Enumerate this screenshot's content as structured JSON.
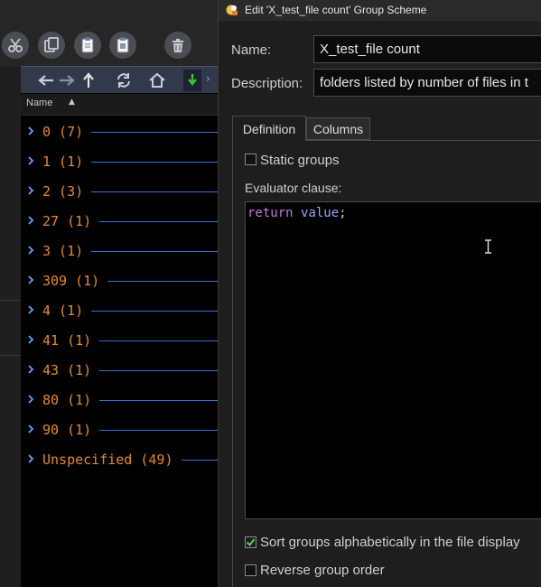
{
  "toolbar": {
    "buttons": [
      {
        "icon": "scissors-icon"
      },
      {
        "icon": "copy-icon"
      },
      {
        "icon": "paste-icon"
      },
      {
        "icon": "clipboard-paste-icon"
      },
      {
        "icon": "trash-icon"
      }
    ]
  },
  "nav": {
    "back_icon": "arrow-left-icon",
    "forward_icon": "arrow-right-icon",
    "up_icon": "arrow-up-icon",
    "refresh_icon": "refresh-icon",
    "home_icon": "home-icon",
    "bookmark_icon": "green-down-arrow-icon"
  },
  "list": {
    "column_header": "Name",
    "groups": [
      {
        "label": "0 (7)"
      },
      {
        "label": "1 (1)"
      },
      {
        "label": "2 (3)"
      },
      {
        "label": "27 (1)"
      },
      {
        "label": "3 (1)"
      },
      {
        "label": "309 (1)"
      },
      {
        "label": "4 (1)"
      },
      {
        "label": "41 (1)"
      },
      {
        "label": "43 (1)"
      },
      {
        "label": "80 (1)"
      },
      {
        "label": "90 (1)"
      },
      {
        "label": "Unspecified (49)"
      }
    ]
  },
  "dialog": {
    "title": "Edit 'X_test_file count' Group Scheme",
    "name_label": "Name:",
    "name_value": "X_test_file count",
    "description_label": "Description:",
    "description_value": "folders listed by number of files in t",
    "tabs": [
      "Definition",
      "Columns"
    ],
    "static_groups_label": "Static groups",
    "static_groups_checked": false,
    "evaluator_label": "Evaluator clause:",
    "code": {
      "keyword": "return",
      "identifier": "value",
      "punct": ";"
    },
    "sort_label": "Sort groups alphabetically in the file display",
    "sort_checked": true,
    "reverse_label": "Reverse group order",
    "reverse_checked": false
  },
  "colors": {
    "accent_orange": "#e8882d",
    "group_line_blue": "#3c6fd6",
    "keyword_purple": "#c678dd",
    "identifier_blue": "#9aa3ff"
  }
}
